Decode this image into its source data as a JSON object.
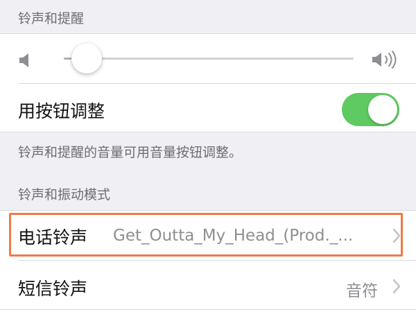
{
  "ringer_section": {
    "header": "铃声和提醒",
    "slider_value_fraction": 0.03,
    "change_with_buttons": {
      "label": "用按钮调整",
      "enabled": true
    },
    "footer": "铃声和提醒的音量可用音量按钮调整。"
  },
  "patterns_section": {
    "header": "铃声和振动模式",
    "rows": [
      {
        "label": "电话铃声",
        "value": "Get_Outta_My_Head_(Prod._..."
      },
      {
        "label": "短信铃声",
        "value": "音符"
      }
    ]
  },
  "colors": {
    "toggle_on": "#5fc962",
    "highlight_border": "#f07a44",
    "background": "#efeff4"
  },
  "icons": [
    "speaker-low-icon",
    "speaker-high-icon",
    "chevron-right-icon"
  ]
}
